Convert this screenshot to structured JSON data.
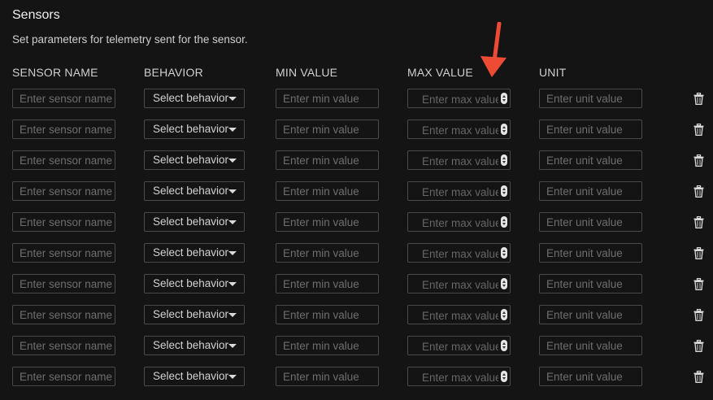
{
  "section": {
    "title": "Sensors",
    "description": "Set parameters for telemetry sent for the sensor."
  },
  "columns": {
    "name": "SENSOR NAME",
    "behavior": "BEHAVIOR",
    "min": "MIN VALUE",
    "max": "MAX VALUE",
    "unit": "UNIT"
  },
  "placeholders": {
    "name": "Enter sensor name",
    "min": "Enter min value",
    "max": "Enter max value",
    "unit": "Enter unit value"
  },
  "behavior_select_label": "Select behavior",
  "icons": {
    "delete": "trash-icon",
    "annotation": "red-arrow-icon",
    "stepper": "number-stepper-icon",
    "dropdown": "caret-down-icon"
  },
  "colors": {
    "background": "#141414",
    "border": "#4a4a4a",
    "annotation_arrow": "#ee4b35"
  },
  "rows": [
    {
      "name": "",
      "behavior": "",
      "min": "",
      "max": "",
      "unit": ""
    },
    {
      "name": "",
      "behavior": "",
      "min": "",
      "max": "",
      "unit": ""
    },
    {
      "name": "",
      "behavior": "",
      "min": "",
      "max": "",
      "unit": ""
    },
    {
      "name": "",
      "behavior": "",
      "min": "",
      "max": "",
      "unit": ""
    },
    {
      "name": "",
      "behavior": "",
      "min": "",
      "max": "",
      "unit": ""
    },
    {
      "name": "",
      "behavior": "",
      "min": "",
      "max": "",
      "unit": ""
    },
    {
      "name": "",
      "behavior": "",
      "min": "",
      "max": "",
      "unit": ""
    },
    {
      "name": "",
      "behavior": "",
      "min": "",
      "max": "",
      "unit": ""
    },
    {
      "name": "",
      "behavior": "",
      "min": "",
      "max": "",
      "unit": ""
    },
    {
      "name": "",
      "behavior": "",
      "min": "",
      "max": "",
      "unit": ""
    }
  ]
}
